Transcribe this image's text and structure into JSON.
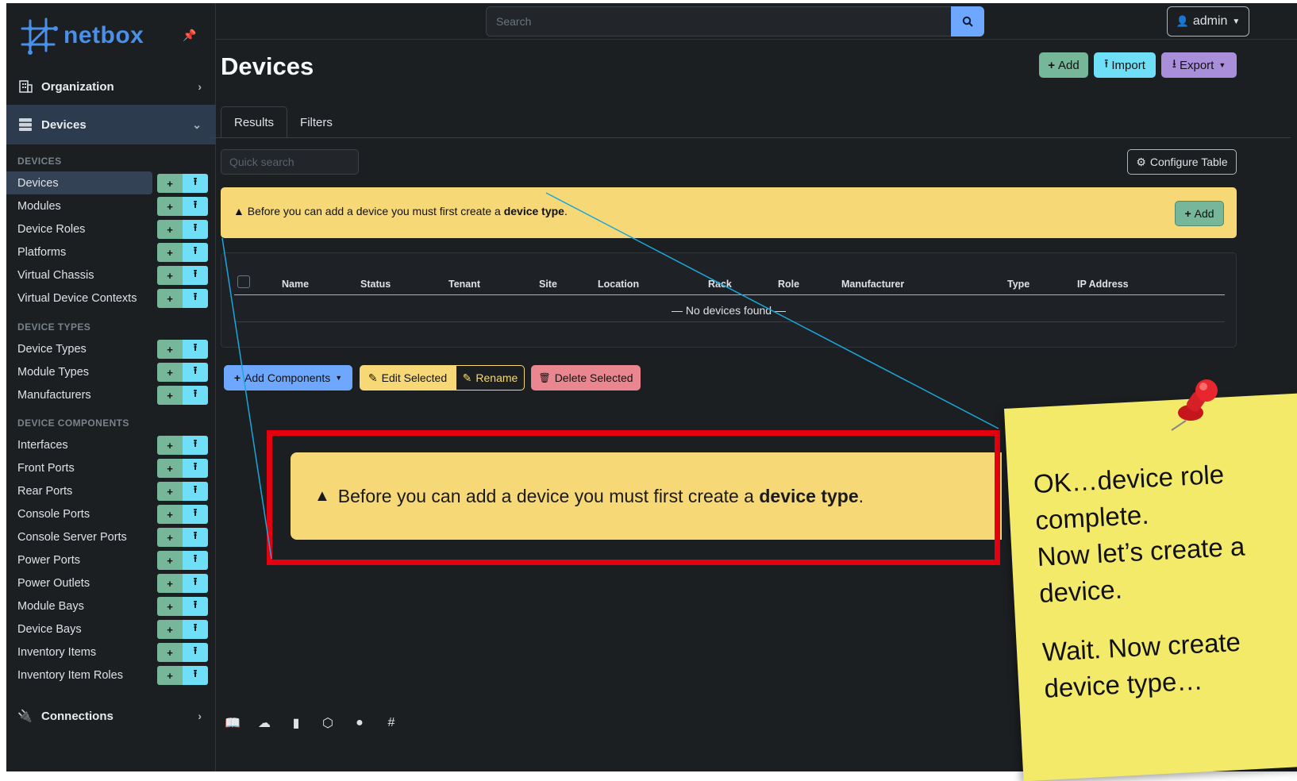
{
  "brand": {
    "name": "netbox"
  },
  "sidebar": {
    "organization": "Organization",
    "devices_menu": "Devices",
    "connections": "Connections",
    "groups": [
      {
        "label": "DEVICES",
        "items": [
          "Devices",
          "Modules",
          "Device Roles",
          "Platforms",
          "Virtual Chassis",
          "Virtual Device Contexts"
        ]
      },
      {
        "label": "DEVICE TYPES",
        "items": [
          "Device Types",
          "Module Types",
          "Manufacturers"
        ]
      },
      {
        "label": "DEVICE COMPONENTS",
        "items": [
          "Interfaces",
          "Front Ports",
          "Rear Ports",
          "Console Ports",
          "Console Server Ports",
          "Power Ports",
          "Power Outlets",
          "Module Bays",
          "Device Bays",
          "Inventory Items",
          "Inventory Item Roles"
        ]
      }
    ],
    "active_item": "Devices",
    "add_glyph": "+",
    "import_glyph": "⭱"
  },
  "topbar": {
    "search_placeholder": "Search",
    "user": "admin"
  },
  "page": {
    "title": "Devices",
    "add_label": "Add",
    "import_label": "Import",
    "export_label": "Export",
    "tabs": [
      "Results",
      "Filters"
    ],
    "quick_search_placeholder": "Quick search",
    "configure_table": "Configure Table",
    "alert": {
      "prefix": "Before you can add a device you must first create a ",
      "emphasis": "device type",
      "suffix": ".",
      "add_label": "Add"
    },
    "columns": [
      "Name",
      "Status",
      "Tenant",
      "Site",
      "Location",
      "Rack",
      "Role",
      "Manufacturer",
      "Type",
      "IP Address"
    ],
    "empty_text": "— No devices found —",
    "actions": {
      "add_components": "Add Components",
      "edit_selected": "Edit Selected",
      "rename": "Rename",
      "delete_selected": "Delete Selected"
    }
  },
  "callout": {
    "prefix": "Before you can add a device you must first create a ",
    "emphasis": "device type",
    "suffix": "."
  },
  "sticky_note": {
    "lines": [
      "OK…device role",
      "complete.",
      "Now let’s create a",
      "device.",
      "",
      "Wait.  Now create",
      "device type…"
    ]
  },
  "colors": {
    "accent": "#6ea8fe",
    "success": "#75b798",
    "info": "#6edff6",
    "export": "#a98eda",
    "warning": "#f7d877",
    "danger": "#ea868f",
    "callout_border": "#e3000f",
    "sticky": "#f3ea6a"
  }
}
